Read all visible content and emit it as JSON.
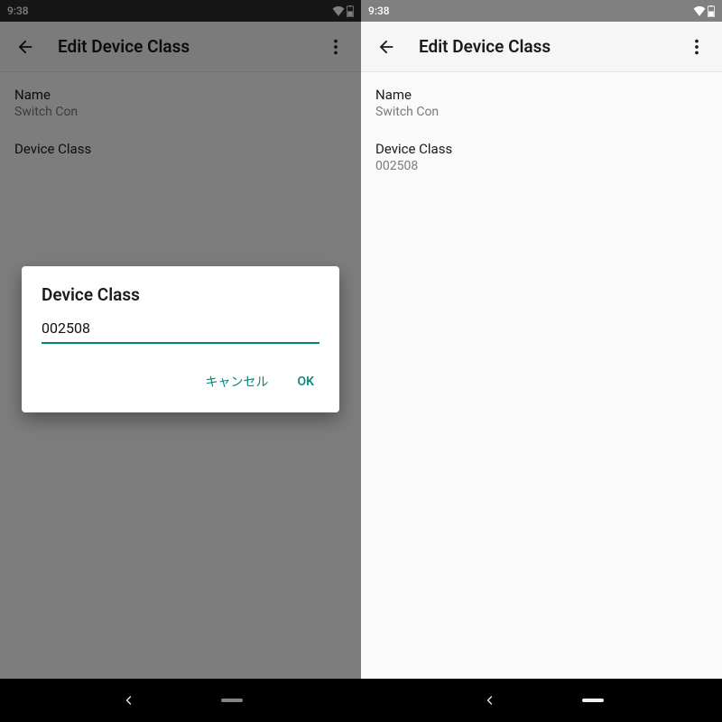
{
  "colors": {
    "accent": "#008577"
  },
  "left": {
    "status": {
      "time": "9:38"
    },
    "appbar": {
      "title": "Edit Device Class"
    },
    "fields": {
      "name": {
        "label": "Name",
        "value": "Switch Con"
      },
      "device_class": {
        "label": "Device Class",
        "value": ""
      }
    },
    "dialog": {
      "title": "Device Class",
      "input_value": "002508",
      "cancel_label": "キャンセル",
      "ok_label": "OK"
    }
  },
  "right": {
    "status": {
      "time": "9:38"
    },
    "appbar": {
      "title": "Edit Device Class"
    },
    "fields": {
      "name": {
        "label": "Name",
        "value": "Switch Con"
      },
      "device_class": {
        "label": "Device Class",
        "value": "002508"
      }
    }
  }
}
